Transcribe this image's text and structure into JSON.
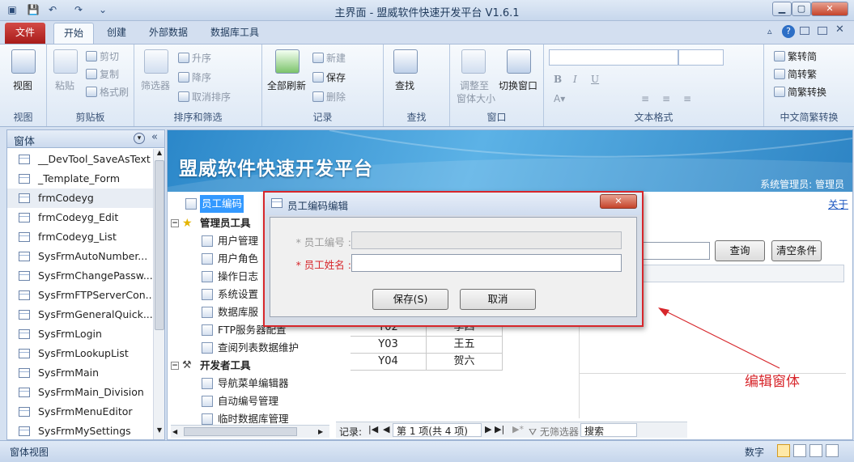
{
  "app": {
    "title": "主界面 - 盟威软件快速开发平台 V1.6.1"
  },
  "tabs": [
    "文件",
    "开始",
    "创建",
    "外部数据",
    "数据库工具"
  ],
  "ribbon": {
    "view": {
      "label": "视图",
      "group": "视图"
    },
    "clipboard": {
      "paste": "粘贴",
      "cut": "剪切",
      "copy": "复制",
      "format_painter": "格式刷",
      "group": "剪贴板"
    },
    "sort": {
      "filter": "筛选器",
      "asc": "升序",
      "desc": "降序",
      "clear_sort": "取消排序",
      "group": "排序和筛选"
    },
    "records": {
      "refresh": "全部刷新",
      "new": "新建",
      "save": "保存",
      "delete": "删除",
      "group": "记录"
    },
    "find": {
      "find": "查找",
      "group": "查找"
    },
    "window": {
      "fit": "调整至",
      "fit2": "窗体大小",
      "switch": "切换窗口",
      "group": "窗口"
    },
    "text_format": {
      "bold": "B",
      "italic": "I",
      "underline": "U",
      "group": "文本格式"
    },
    "chinese": {
      "t2s": "繁转简",
      "s2t": "简转繁",
      "convert": "简繁转换",
      "group": "中文简繁转换"
    }
  },
  "nav": {
    "header": "窗体",
    "items": [
      "__DevTool_SaveAsText",
      "_Template_Form",
      "frmCodeyg",
      "frmCodeyg_Edit",
      "frmCodeyg_List",
      "SysFrmAutoNumber...",
      "SysFrmChangePassw...",
      "SysFrmFTPServerCon...",
      "SysFrmGeneralQuick...",
      "SysFrmLogin",
      "SysFrmLookupList",
      "SysFrmMain",
      "SysFrmMain_Division",
      "SysFrmMenuEditor",
      "SysFrmMySettings"
    ]
  },
  "banner": {
    "title": "盟威软件快速开发平台",
    "user": "系统管理员: 管理员",
    "about": "关于"
  },
  "tree": {
    "current": "员工编码",
    "admin_section": "管理员工具",
    "admin_items": [
      "用户管理",
      "用户角色",
      "操作日志",
      "系统设置",
      "数据库服",
      "FTP服务器配置",
      "查阅列表数据维护"
    ],
    "dev_section": "开发者工具",
    "dev_items": [
      "导航菜单编辑器",
      "自动编号管理",
      "临时数据库管理"
    ]
  },
  "search_panel": {
    "query_button": "查询",
    "clear_button": "清空条件"
  },
  "grid": {
    "rows": [
      [
        "Y02",
        "李四"
      ],
      [
        "Y03",
        "王五"
      ],
      [
        "Y04",
        "贺六"
      ]
    ]
  },
  "record_bar": {
    "label": "记录:",
    "position": "第 1 项(共 4 项)",
    "no_filter": "无筛选器",
    "search": "搜索"
  },
  "status": {
    "view": "窗体视图",
    "mode": "数字"
  },
  "dialog": {
    "title": "员工编码编辑",
    "id_label": "* 员工编号 :",
    "id_value": "",
    "name_label": "* 员工姓名 :",
    "name_value": "",
    "save": "保存(S)",
    "cancel": "取消"
  },
  "annotation": {
    "text": "编辑窗体"
  },
  "colors": {
    "accent": "#d7262b",
    "banner": "#3a99d8",
    "selection": "#3399ff"
  }
}
